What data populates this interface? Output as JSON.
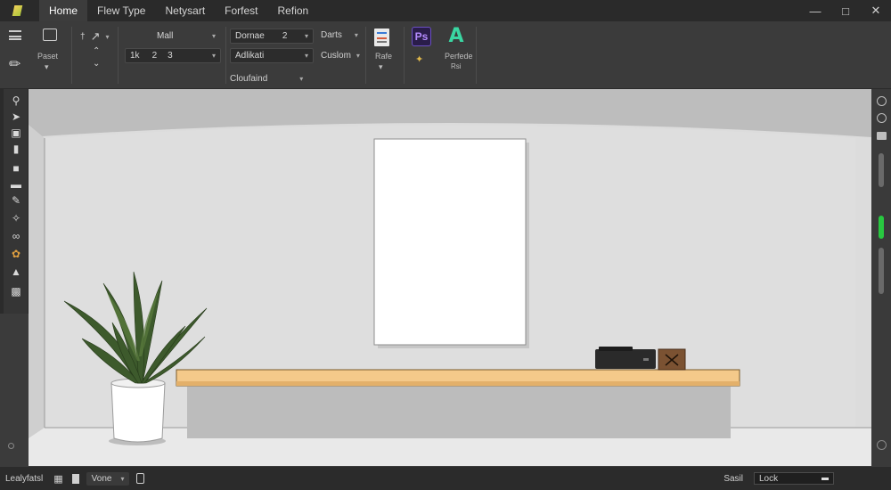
{
  "tabs": [
    {
      "label": "Home",
      "active": true
    },
    {
      "label": "Flew Type"
    },
    {
      "label": "Netysart"
    },
    {
      "label": "Forfest"
    },
    {
      "label": "Refion"
    }
  ],
  "window": {
    "minimize_icon": "minimize-icon",
    "maximize_icon": "maximize-icon",
    "close_icon": "close-icon"
  },
  "ribbon": {
    "paste_label": "Paset",
    "font_name": "Mall",
    "font_size_a": "1k",
    "font_size_b": "2",
    "font_size_c": "3",
    "style_name": "Dornae",
    "style_size": "2",
    "align_label": "Adlikati",
    "darts_label": "Darts",
    "custom_label": "Cuslom",
    "section_label": "Cloufaind",
    "rafe_label": "Rafe",
    "app_label_1": "Perfede",
    "app_label_2": "Rsi",
    "ps_text": "Ps",
    "ai_text": "A"
  },
  "statusbar": {
    "layer_label": "Lealyfatsl",
    "mode_label": "Vone",
    "scale_label": "Sasil",
    "lock_label": "Lock"
  },
  "colors": {
    "shelf": "#f4c98a",
    "plant_leaf": "#3d5a2c",
    "accent_green": "#28c840"
  }
}
